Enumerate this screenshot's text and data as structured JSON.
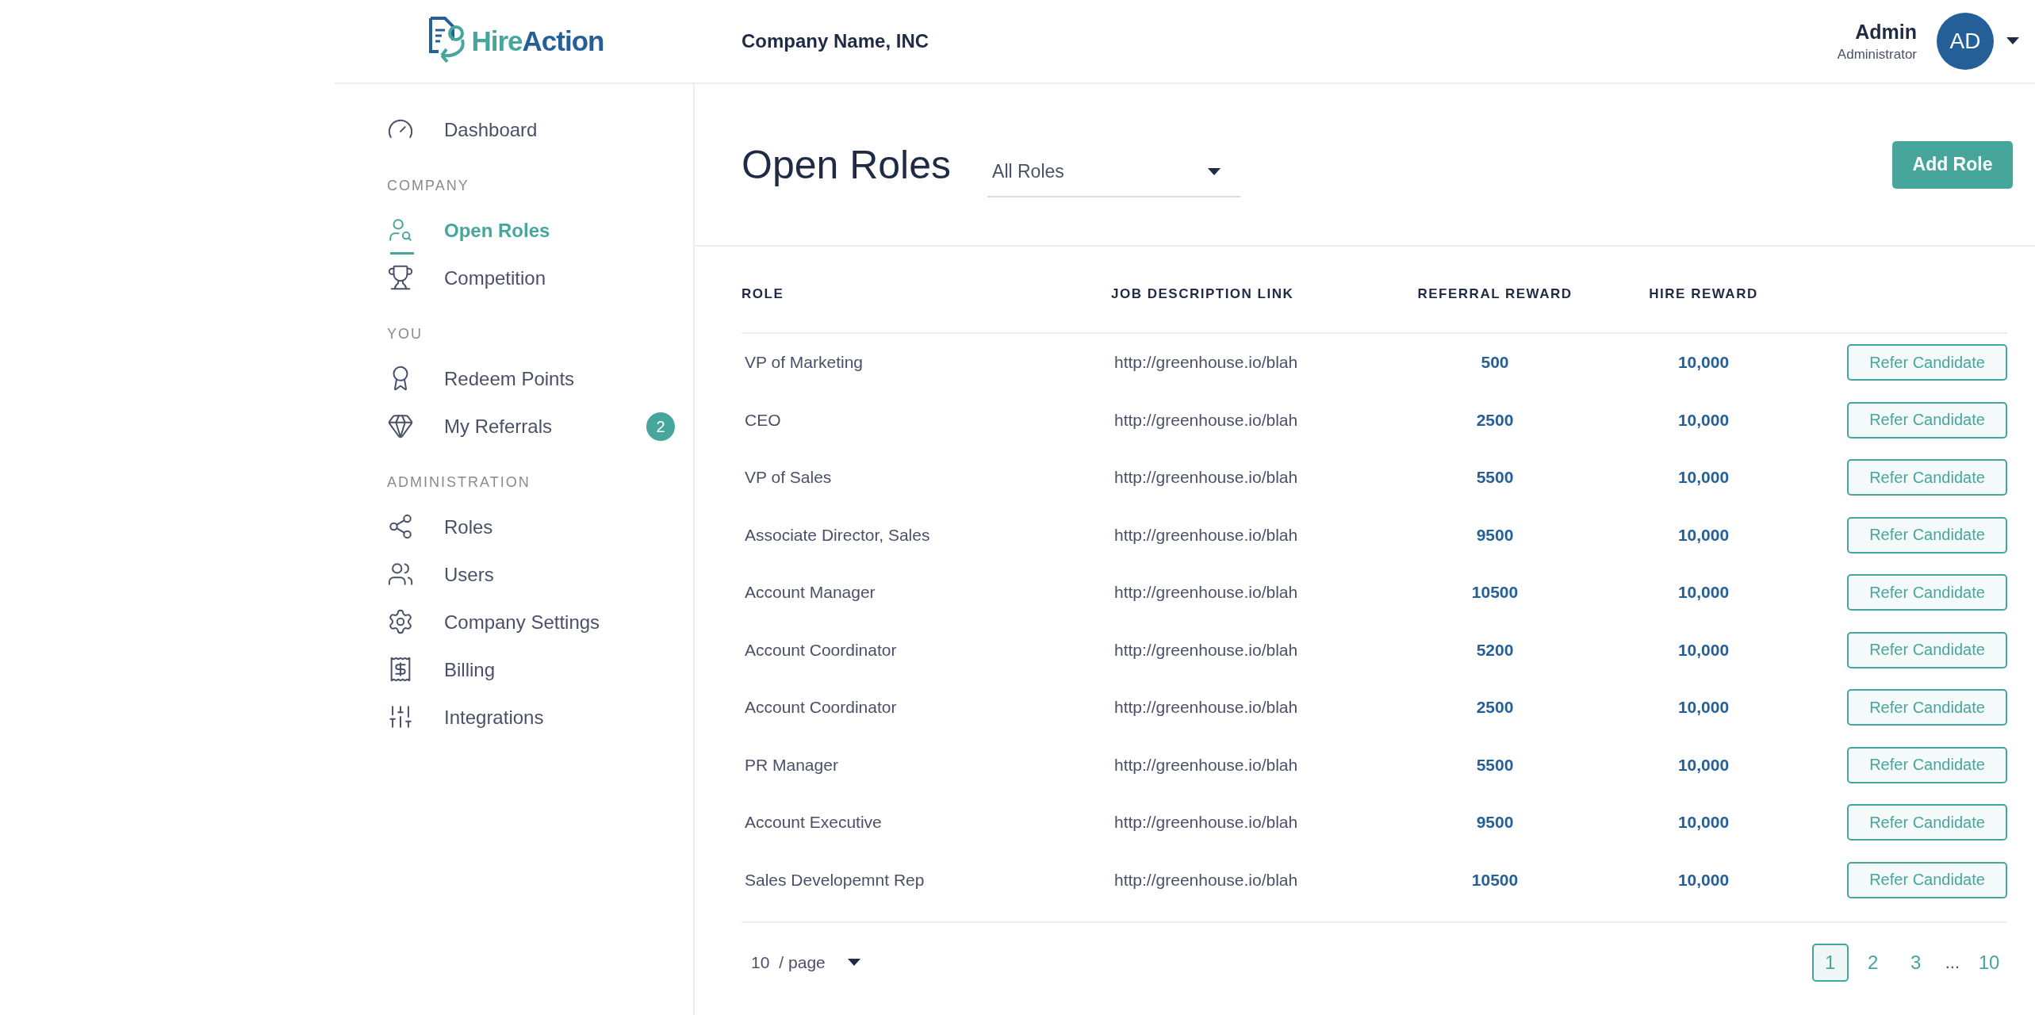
{
  "header": {
    "logo": {
      "part_1": "Hire",
      "part_2": "Action"
    },
    "company": "Company Name, INC",
    "user": {
      "name": "Admin",
      "role": "Administrator",
      "initials": "AD"
    }
  },
  "sidebar": {
    "sections": [
      {
        "items": [
          {
            "label": "Dashboard",
            "selected": false
          }
        ]
      },
      {
        "heading": "COMPANY",
        "items": [
          {
            "label": "Open Roles",
            "selected": true
          },
          {
            "label": "Competition",
            "selected": false
          }
        ]
      },
      {
        "heading": "YOU",
        "items": [
          {
            "label": "Redeem Points",
            "selected": false
          },
          {
            "label": "My Referrals",
            "selected": false,
            "badge": "2"
          }
        ]
      },
      {
        "heading": "ADMINISTRATION",
        "items": [
          {
            "label": "Roles",
            "selected": false
          },
          {
            "label": "Users",
            "selected": false
          },
          {
            "label": "Company Settings",
            "selected": false
          },
          {
            "label": "Billing",
            "selected": false
          },
          {
            "label": "Integrations",
            "selected": false
          }
        ]
      }
    ]
  },
  "page": {
    "title": "Open Roles",
    "filter": {
      "value": "All Roles"
    },
    "add_button": "Add Role"
  },
  "table": {
    "columns": [
      "ROLE",
      "JOB DESCRIPTION LINK",
      "REFERRAL REWARD",
      "HIRE REWARD"
    ],
    "rows": [
      {
        "role": "VP of Marketing",
        "link": "http://greenhouse.io/blah",
        "referral_reward": "500",
        "hire_reward": "10,000",
        "action": "Refer Candidate"
      },
      {
        "role": "CEO",
        "link": "http://greenhouse.io/blah",
        "referral_reward": "2500",
        "hire_reward": "10,000",
        "action": "Refer Candidate"
      },
      {
        "role": "VP of Sales",
        "link": "http://greenhouse.io/blah",
        "referral_reward": "5500",
        "hire_reward": "10,000",
        "action": "Refer Candidate"
      },
      {
        "role": "Associate Director, Sales",
        "link": "http://greenhouse.io/blah",
        "referral_reward": "9500",
        "hire_reward": "10,000",
        "action": "Refer Candidate"
      },
      {
        "role": "Account Manager",
        "link": "http://greenhouse.io/blah",
        "referral_reward": "10500",
        "hire_reward": "10,000",
        "action": "Refer Candidate"
      },
      {
        "role": "Account Coordinator",
        "link": "http://greenhouse.io/blah",
        "referral_reward": "5200",
        "hire_reward": "10,000",
        "action": "Refer Candidate"
      },
      {
        "role": "Account Coordinator",
        "link": "http://greenhouse.io/blah",
        "referral_reward": "2500",
        "hire_reward": "10,000",
        "action": "Refer Candidate"
      },
      {
        "role": "PR Manager",
        "link": "http://greenhouse.io/blah",
        "referral_reward": "5500",
        "hire_reward": "10,000",
        "action": "Refer Candidate"
      },
      {
        "role": "Account Executive",
        "link": "http://greenhouse.io/blah",
        "referral_reward": "9500",
        "hire_reward": "10,000",
        "action": "Refer Candidate"
      },
      {
        "role": "Sales Developemnt Rep",
        "link": "http://greenhouse.io/blah",
        "referral_reward": "10500",
        "hire_reward": "10,000",
        "action": "Refer Candidate"
      }
    ]
  },
  "pagination": {
    "per_page": "10",
    "per_page_suffix": "/ page",
    "pages": [
      {
        "kind": "page",
        "label": "1",
        "selected": true
      },
      {
        "kind": "page",
        "label": "2",
        "selected": false
      },
      {
        "kind": "page",
        "label": "3",
        "selected": false
      },
      {
        "kind": "ellipsis",
        "label": "...",
        "selected": false
      },
      {
        "kind": "page",
        "label": "10",
        "selected": false
      }
    ]
  }
}
